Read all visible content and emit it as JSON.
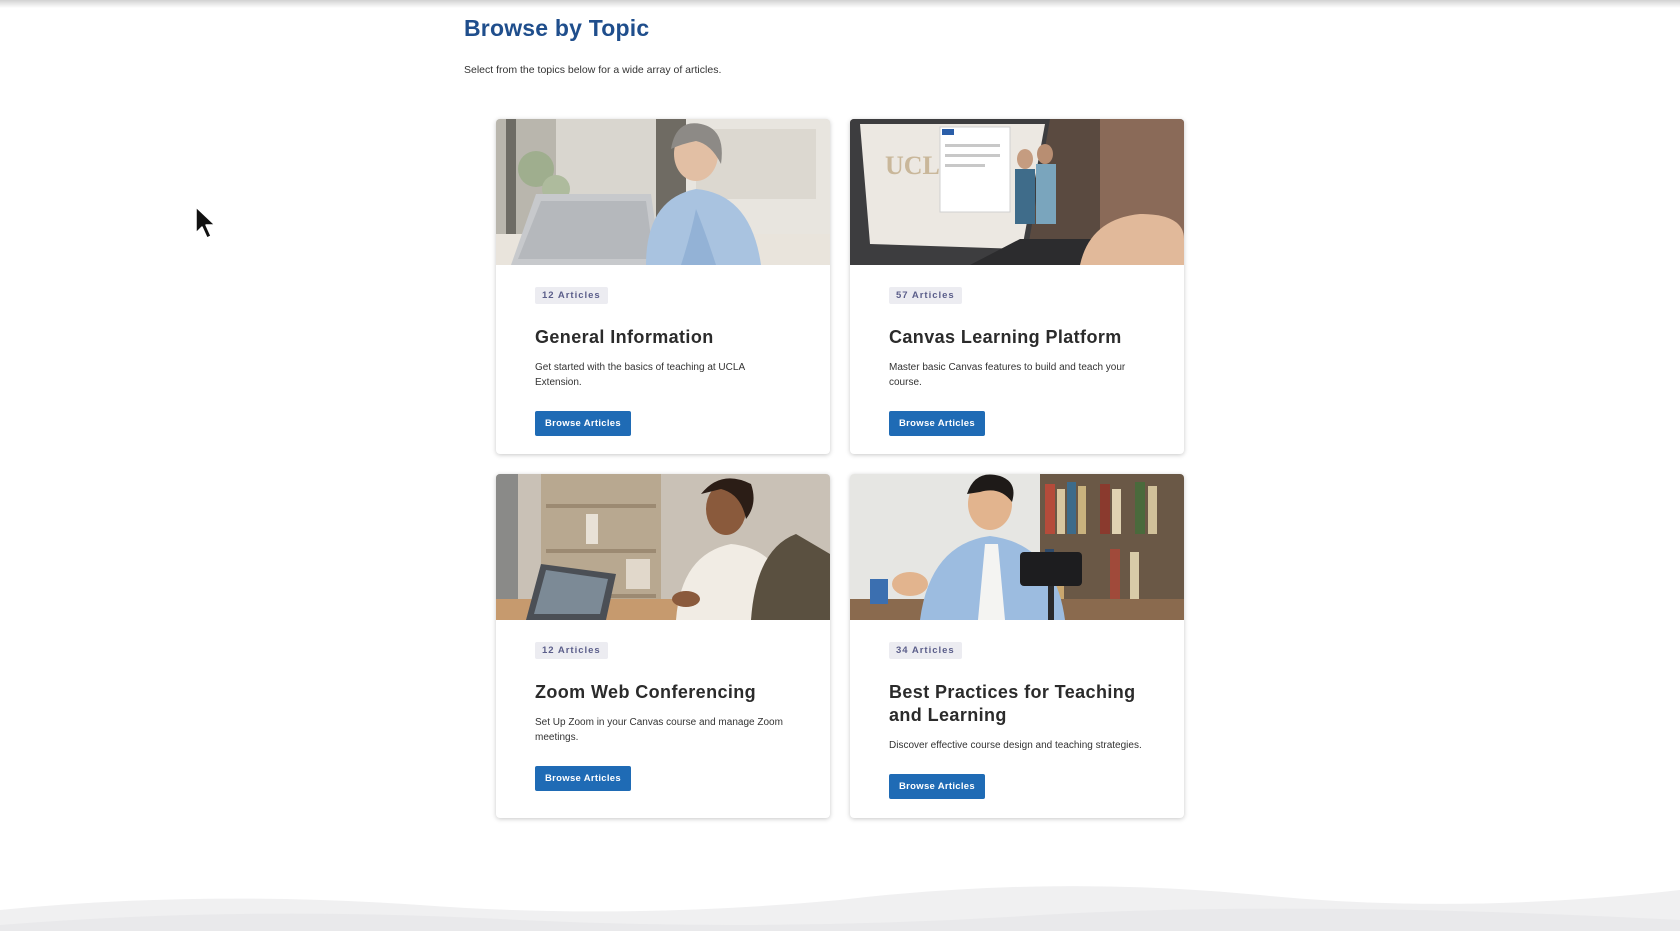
{
  "header": {
    "title": "Browse by Topic",
    "subtitle": "Select from the topics below for a wide array of articles."
  },
  "cards": [
    {
      "badge": "12 Articles",
      "title": "General Information",
      "description": "Get started with the basics of teaching at UCLA Extension.",
      "button": "Browse Articles"
    },
    {
      "badge": "57 Articles",
      "title": "Canvas Learning Platform",
      "description": "Master basic Canvas features to build and teach your course.",
      "button": "Browse Articles",
      "image_text": "UCLA"
    },
    {
      "badge": "12 Articles",
      "title": "Zoom Web Conferencing",
      "description": "Set Up Zoom in your Canvas course and manage Zoom meetings.",
      "button": "Browse Articles"
    },
    {
      "badge": "34 Articles",
      "title": "Best Practices for Teaching and Learning",
      "description": "Discover effective course design and teaching strategies.",
      "button": "Browse Articles"
    }
  ],
  "colors": {
    "title": "#1f4e8c",
    "button": "#1f6bb5",
    "badge_bg": "#ececf1",
    "badge_text": "#5b5e8a"
  }
}
